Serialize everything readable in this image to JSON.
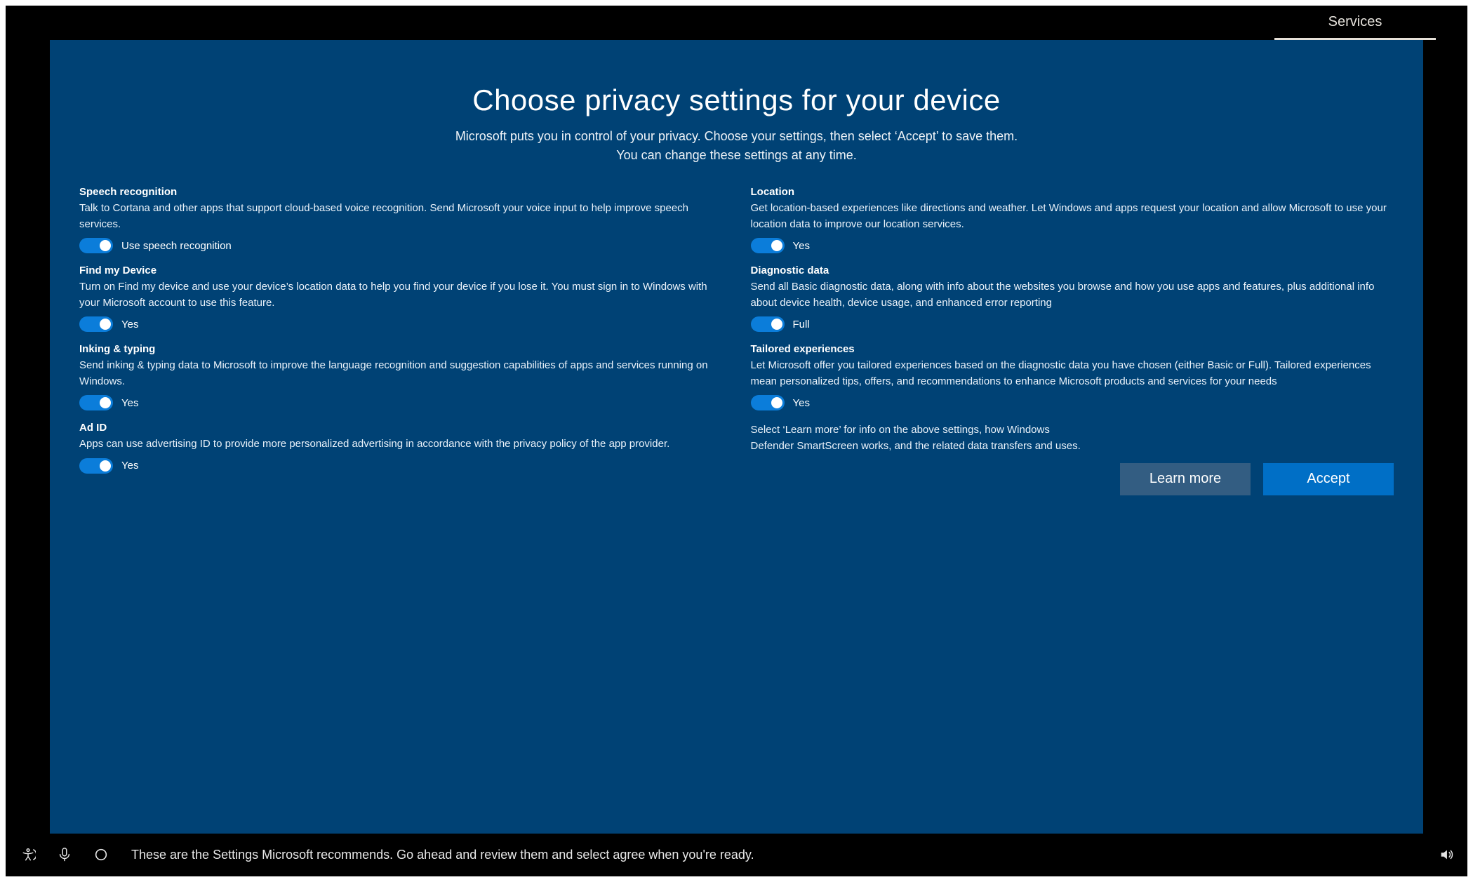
{
  "header": {
    "tab_label": "Services"
  },
  "page": {
    "title": "Choose privacy settings for your device",
    "subtitle_line1": "Microsoft puts you in control of your privacy. Choose your settings, then select ‘Accept’ to save them.",
    "subtitle_line2": "You can change these settings at any time."
  },
  "settings": {
    "speech": {
      "title": "Speech recognition",
      "desc": "Talk to Cortana and other apps that support cloud-based voice recognition.  Send Microsoft your voice input to help improve speech services.",
      "toggle_label": "Use speech recognition",
      "on": true
    },
    "find": {
      "title": "Find my Device",
      "desc": "Turn on Find my device and use your device’s location data to help you find your device if you lose it. You must sign in to Windows with your Microsoft account to use this feature.",
      "toggle_label": "Yes",
      "on": true
    },
    "inking": {
      "title": "Inking & typing",
      "desc": "Send inking & typing data to Microsoft to improve the language recognition and suggestion capabilities of apps and services running on Windows.",
      "toggle_label": "Yes",
      "on": true
    },
    "adid": {
      "title": "Ad ID",
      "desc": "Apps can use advertising ID to provide more personalized advertising in accordance with the privacy policy of the app provider.",
      "toggle_label": "Yes",
      "on": true
    },
    "location": {
      "title": "Location",
      "desc": "Get location-based experiences like directions and weather.  Let Windows and apps request your location and allow Microsoft to use your location data to improve our location services.",
      "toggle_label": "Yes",
      "on": true
    },
    "diag": {
      "title": "Diagnostic data",
      "desc": "Send all Basic diagnostic data, along with info about the websites you browse and how you use apps and features, plus additional info about device health, device usage, and enhanced error reporting",
      "toggle_label": "Full",
      "on": true
    },
    "tailored": {
      "title": "Tailored experiences",
      "desc": "Let Microsoft offer you tailored experiences based on the diagnostic data you have chosen (either Basic or Full). Tailored experiences mean personalized tips, offers, and recommendations to enhance Microsoft products and services for your needs",
      "toggle_label": "Yes",
      "on": true
    }
  },
  "footnote": {
    "line1": "Select ‘Learn more’ for info on the above settings, how Windows",
    "line2": "Defender SmartScreen works, and the related data transfers and uses."
  },
  "buttons": {
    "learn_more": "Learn more",
    "accept": "Accept"
  },
  "bottombar": {
    "narration": "These are the Settings Microsoft recommends. Go ahead and review them and select agree when you're ready."
  }
}
